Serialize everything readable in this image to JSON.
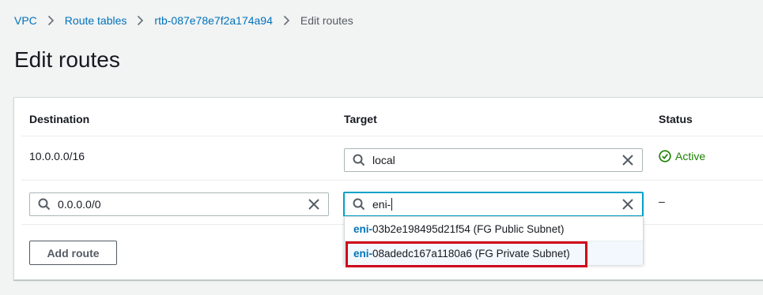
{
  "breadcrumb": {
    "items": [
      "VPC",
      "Route tables",
      "rtb-087e78e7f2a174a94"
    ],
    "current": "Edit routes"
  },
  "page": {
    "title": "Edit routes"
  },
  "table": {
    "headers": {
      "destination": "Destination",
      "target": "Target",
      "status": "Status"
    },
    "rows": [
      {
        "destination": "10.0.0.0/16",
        "target": "local",
        "status": "Active"
      },
      {
        "destination": "0.0.0.0/0",
        "target": "eni-",
        "status": "–"
      }
    ]
  },
  "dropdown": {
    "options": [
      {
        "match": "eni-",
        "rest": "03b2e198495d21f54 (FG Public Subnet)"
      },
      {
        "match": "eni-",
        "rest": "08adedc167a1180a6 (FG Private Subnet)"
      }
    ]
  },
  "actions": {
    "add_route": "Add route"
  },
  "colors": {
    "link": "#0073bb",
    "active_green": "#1d8102",
    "focus_border": "#00a1c9",
    "callout_red": "#d0021b"
  },
  "icons": [
    "chevron-right-icon",
    "search-icon",
    "clear-icon",
    "check-circle-icon"
  ]
}
